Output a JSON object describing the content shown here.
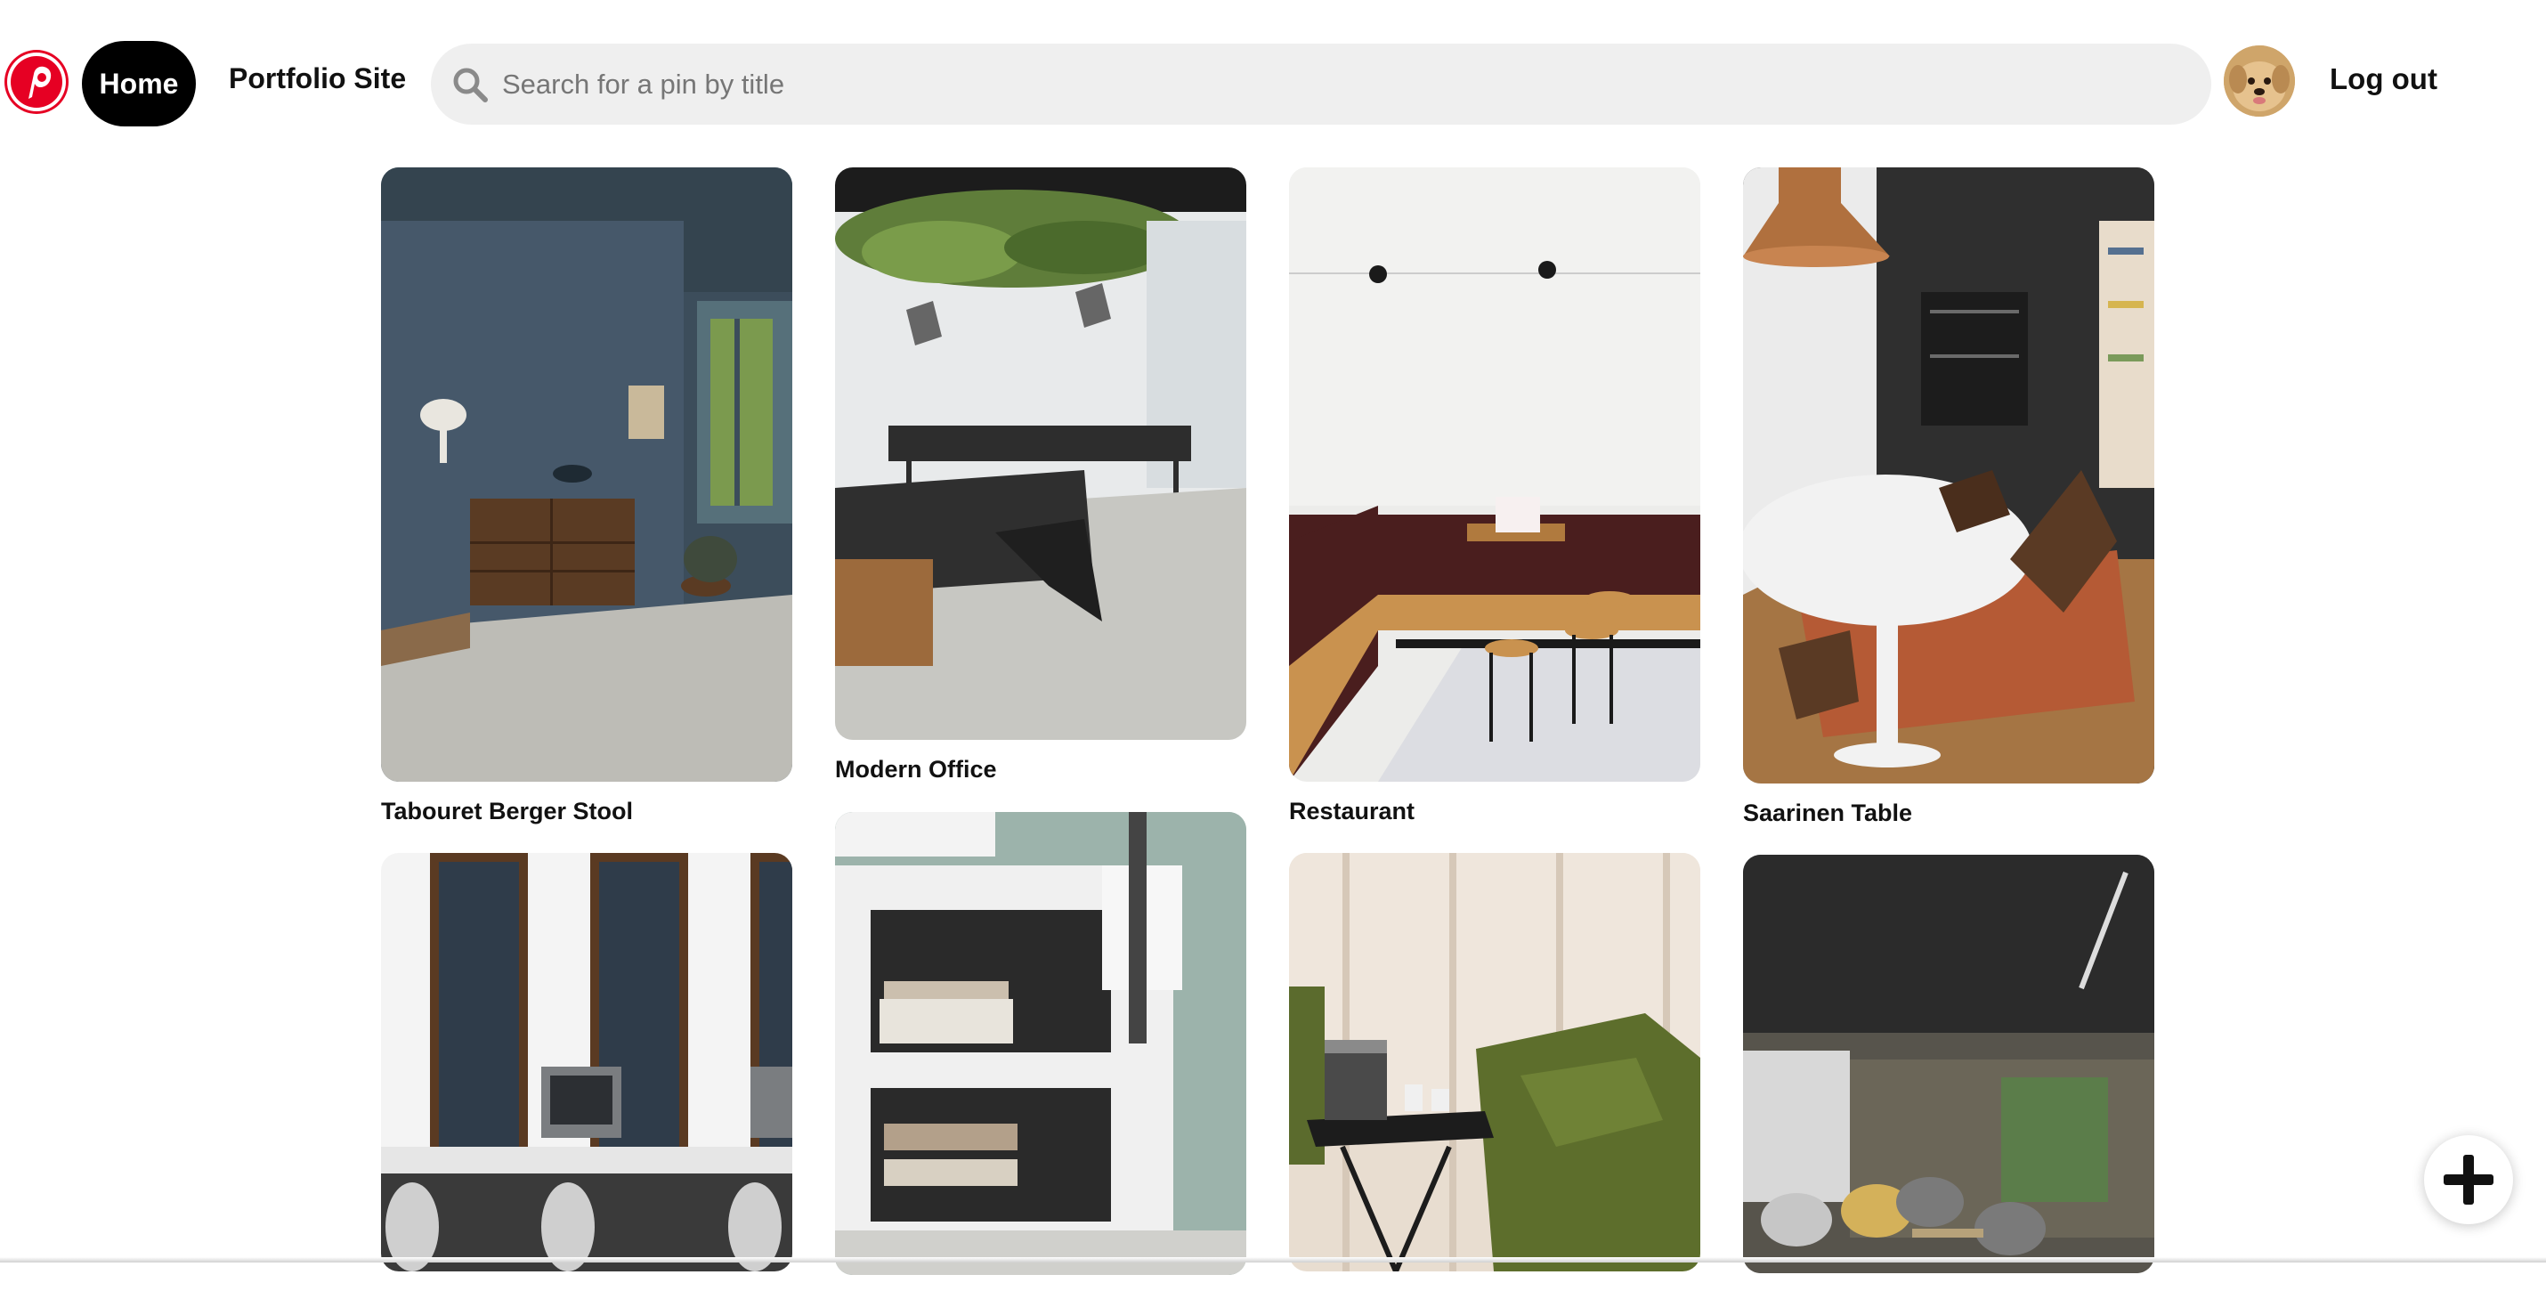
{
  "nav": {
    "logo_icon": "pinterest-logo-icon",
    "home_label": "Home",
    "portfolio_label": "Portfolio Site",
    "logout_label": "Log out",
    "avatar_icon": "user-avatar-dog"
  },
  "search": {
    "placeholder": "Search for a pin by title",
    "value": "",
    "icon": "search-icon"
  },
  "pins": [
    {
      "title": "Tabouret Berger Stool"
    },
    {
      "title": "Modern Office"
    },
    {
      "title": "Restaurant"
    },
    {
      "title": "Saarinen Table"
    },
    {
      "title": ""
    },
    {
      "title": ""
    },
    {
      "title": ""
    },
    {
      "title": ""
    }
  ],
  "fab": {
    "icon": "plus-icon"
  },
  "colors": {
    "brand": "#e60023",
    "home_button": "#000000",
    "search_bg": "#efefef"
  }
}
